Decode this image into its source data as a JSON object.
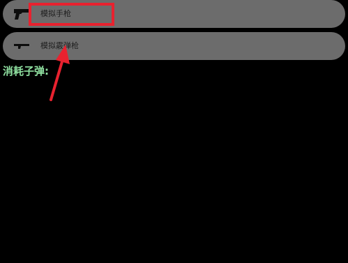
{
  "options": [
    {
      "label": "模拟手枪",
      "icon": "pistol-icon"
    },
    {
      "label": "模拟霰弹枪",
      "icon": "shotgun-icon"
    }
  ],
  "ammo": {
    "label": "消耗子弹:"
  },
  "annotation": {
    "box_color": "#e8222f",
    "arrow_color": "#e8222f"
  },
  "colors": {
    "background": "#000000",
    "pill": "#6c6c6c",
    "label_text": "#1e1e1e",
    "ammo_text": "#8fe0a0"
  }
}
